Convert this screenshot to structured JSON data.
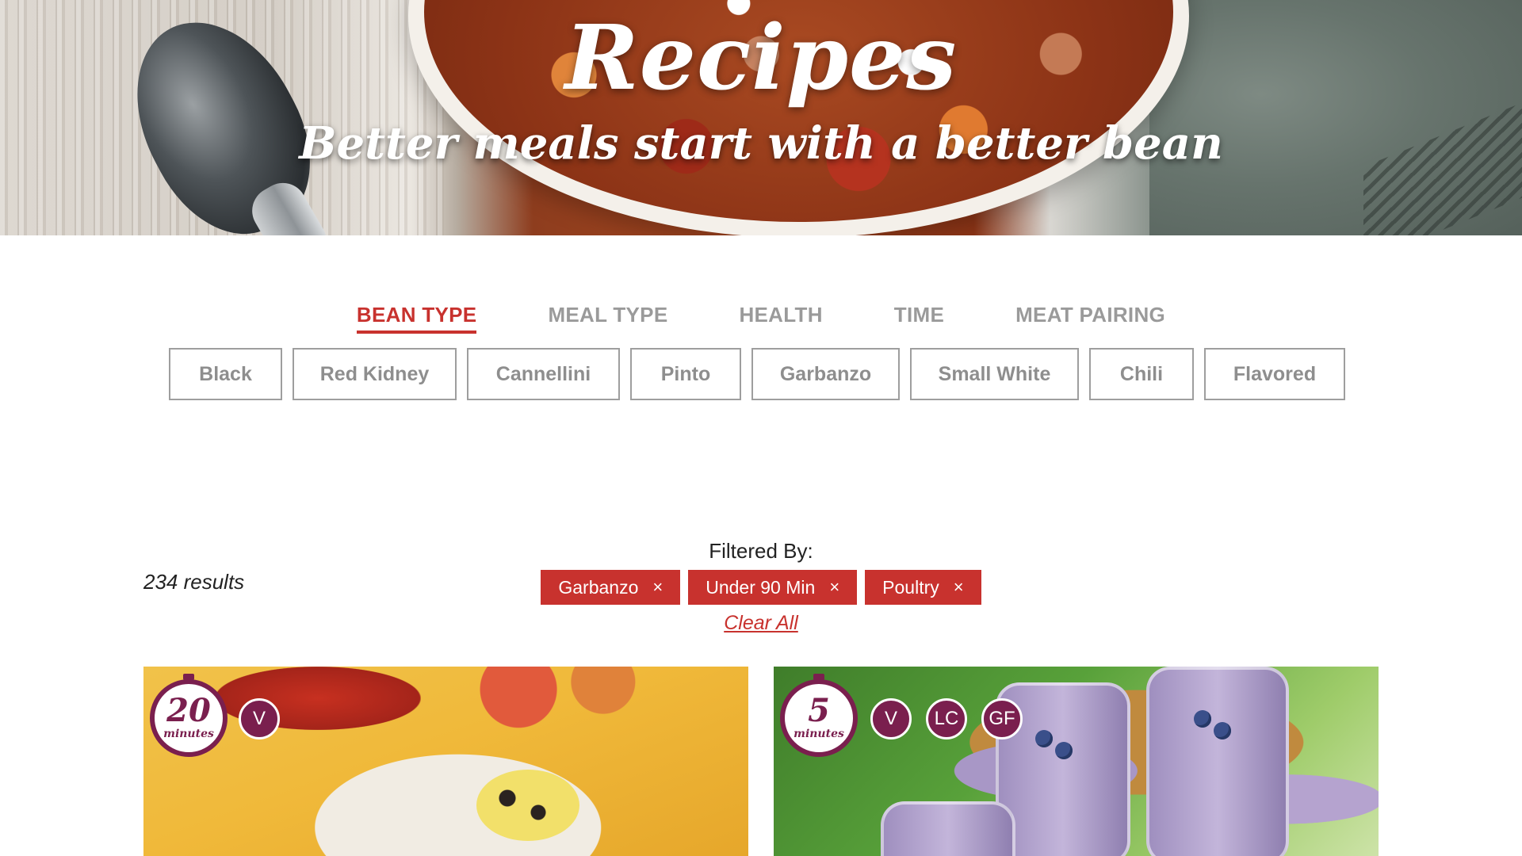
{
  "hero": {
    "title": "Recipes",
    "subtitle": "Better meals start with a better bean"
  },
  "filter_tabs": [
    {
      "label": "BEAN TYPE",
      "active": true
    },
    {
      "label": "MEAL TYPE",
      "active": false
    },
    {
      "label": "HEALTH",
      "active": false
    },
    {
      "label": "TIME",
      "active": false
    },
    {
      "label": "MEAT PAIRING",
      "active": false
    }
  ],
  "bean_options": [
    "Black",
    "Red Kidney",
    "Cannellini",
    "Pinto",
    "Garbanzo",
    "Small White",
    "Chili",
    "Flavored"
  ],
  "results": {
    "count_label": "234 results",
    "filtered_by_label": "Filtered By:",
    "active_filters": [
      "Garbanzo",
      "Under 90 Min",
      "Poultry"
    ],
    "remove_symbol": "×",
    "clear_all_label": "Clear All"
  },
  "cards": [
    {
      "timer_value": "20",
      "timer_unit": "minutes",
      "badges": [
        "V"
      ]
    },
    {
      "timer_value": "5",
      "timer_unit": "minutes",
      "badges": [
        "V",
        "LC",
        "GF"
      ]
    }
  ],
  "colors": {
    "accent": "#c8322e",
    "badge": "#7a1f4e",
    "tab_inactive": "#9a9a9a"
  }
}
